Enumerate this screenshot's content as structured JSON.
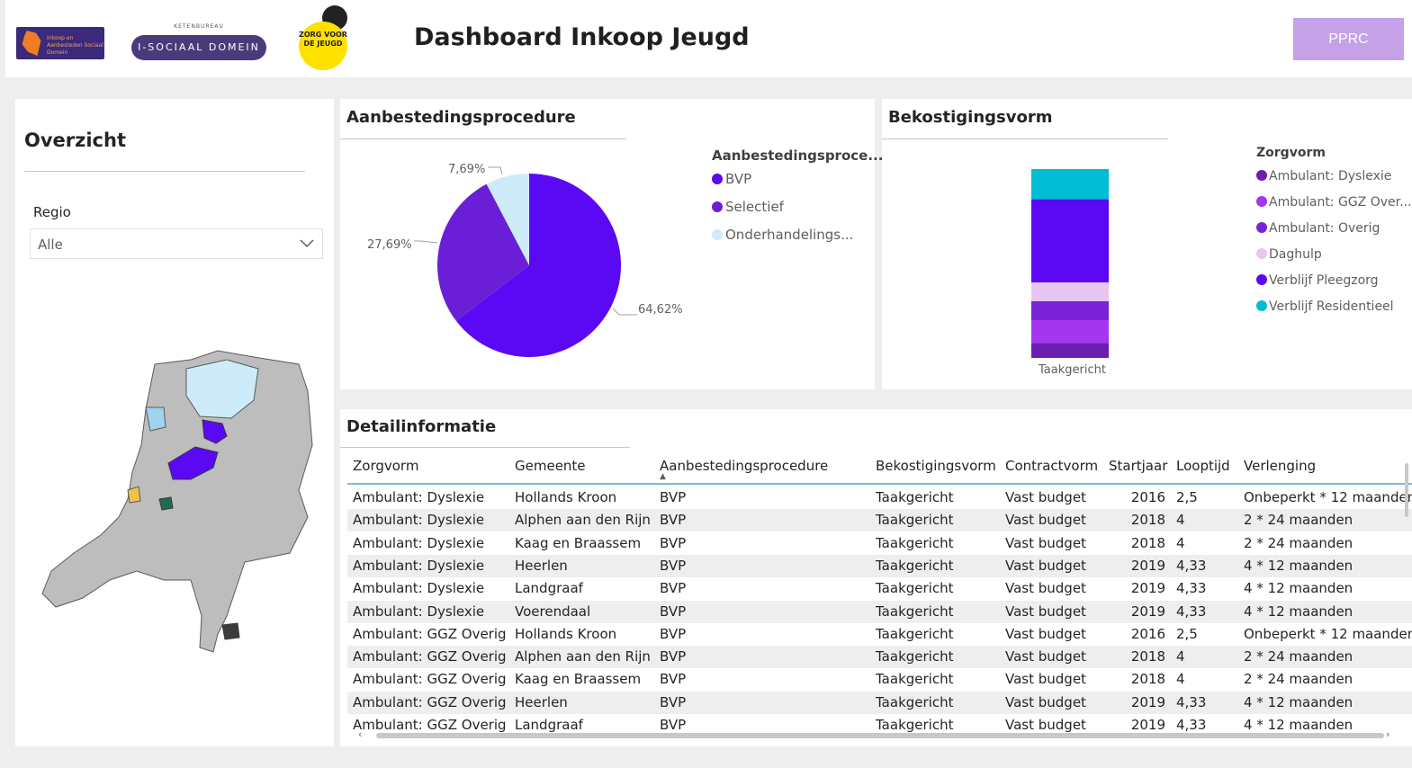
{
  "header": {
    "logo1_text": "Inkoop en Aanbesteden Sociaal Domein",
    "logo2_top": "KETENBUREAU",
    "logo2_text": "I-SOCIAAL DOMEIN",
    "logo3_text": "ZORG VOOR DE JEUGD",
    "title": "Dashboard Inkoop Jeugd",
    "button": "PPRC"
  },
  "overzicht": {
    "title": "Overzicht",
    "regio_label": "Regio",
    "regio_value": "Alle"
  },
  "pie_chart": {
    "title": "Aanbestedingsprocedure",
    "legend_title": "Aanbestedingsproce...",
    "legend": [
      "BVP",
      "Selectief",
      "Onderhandelings..."
    ],
    "labels": [
      "64,62%",
      "27,69%",
      "7,69%"
    ]
  },
  "stack_chart": {
    "title": "Bekostigingsvorm",
    "legend_title": "Zorgvorm",
    "legend": [
      "Ambulant: Dyslexie",
      "Ambulant: GGZ Over...",
      "Ambulant: Overig",
      "Daghulp",
      "Verblijf Pleegzorg",
      "Verblijf Residentieel"
    ],
    "x_label": "Taakgericht"
  },
  "chart_data": [
    {
      "type": "pie",
      "title": "Aanbestedingsprocedure",
      "categories": [
        "BVP",
        "Selectief",
        "Onderhandelings..."
      ],
      "values": [
        64.62,
        27.69,
        7.69
      ],
      "colors": [
        "#5b08f5",
        "#6a1fd6",
        "#cdebf8"
      ]
    },
    {
      "type": "bar",
      "title": "Bekostigingsvorm",
      "categories": [
        "Taakgericht"
      ],
      "series": [
        {
          "name": "Ambulant: Dyslexie",
          "values": [
            8
          ],
          "color": "#6a1fb0"
        },
        {
          "name": "Ambulant: GGZ Over...",
          "values": [
            12
          ],
          "color": "#a535f0"
        },
        {
          "name": "Ambulant: Overig",
          "values": [
            10
          ],
          "color": "#7a22d8"
        },
        {
          "name": "Daghulp",
          "values": [
            10
          ],
          "color": "#e7c6f2"
        },
        {
          "name": "Verblijf Pleegzorg",
          "values": [
            44
          ],
          "color": "#5b08f5"
        },
        {
          "name": "Verblijf Residentieel",
          "values": [
            16
          ],
          "color": "#00bcd4"
        }
      ]
    }
  ],
  "table": {
    "title": "Detailinformatie",
    "headers": [
      "Zorgvorm",
      "Gemeente",
      "Aanbestedingsprocedure",
      "Bekostigingsvorm",
      "Contractvorm",
      "Startjaar",
      "Looptijd",
      "Verlenging"
    ],
    "rows": [
      [
        "Ambulant: Dyslexie",
        "Hollands Kroon",
        "BVP",
        "Taakgericht",
        "Vast budget",
        "2016",
        "2,5",
        "Onbeperkt * 12 maanden"
      ],
      [
        "Ambulant: Dyslexie",
        "Alphen aan den Rijn",
        "BVP",
        "Taakgericht",
        "Vast budget",
        "2018",
        "4",
        "2 * 24 maanden"
      ],
      [
        "Ambulant: Dyslexie",
        "Kaag en Braassem",
        "BVP",
        "Taakgericht",
        "Vast budget",
        "2018",
        "4",
        "2 * 24 maanden"
      ],
      [
        "Ambulant: Dyslexie",
        "Heerlen",
        "BVP",
        "Taakgericht",
        "Vast budget",
        "2019",
        "4,33",
        "4 * 12 maanden"
      ],
      [
        "Ambulant: Dyslexie",
        "Landgraaf",
        "BVP",
        "Taakgericht",
        "Vast budget",
        "2019",
        "4,33",
        "4 * 12 maanden"
      ],
      [
        "Ambulant: Dyslexie",
        "Voerendaal",
        "BVP",
        "Taakgericht",
        "Vast budget",
        "2019",
        "4,33",
        "4 * 12 maanden"
      ],
      [
        "Ambulant: GGZ Overig",
        "Hollands Kroon",
        "BVP",
        "Taakgericht",
        "Vast budget",
        "2016",
        "2,5",
        "Onbeperkt * 12 maanden"
      ],
      [
        "Ambulant: GGZ Overig",
        "Alphen aan den Rijn",
        "BVP",
        "Taakgericht",
        "Vast budget",
        "2018",
        "4",
        "2 * 24 maanden"
      ],
      [
        "Ambulant: GGZ Overig",
        "Kaag en Braassem",
        "BVP",
        "Taakgericht",
        "Vast budget",
        "2018",
        "4",
        "2 * 24 maanden"
      ],
      [
        "Ambulant: GGZ Overig",
        "Heerlen",
        "BVP",
        "Taakgericht",
        "Vast budget",
        "2019",
        "4,33",
        "4 * 12 maanden"
      ],
      [
        "Ambulant: GGZ Overig",
        "Landgraaf",
        "BVP",
        "Taakgericht",
        "Vast budget",
        "2019",
        "4,33",
        "4 * 12 maanden"
      ]
    ]
  }
}
